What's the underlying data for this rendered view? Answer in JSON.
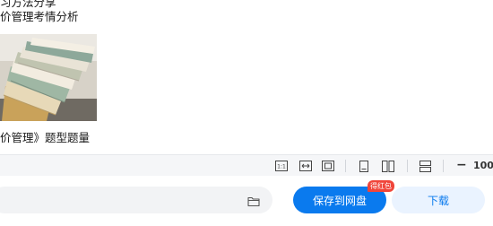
{
  "document": {
    "line1": "习方法分享",
    "line2": "价管理考情分析",
    "line3": "价管理》题型题量"
  },
  "toolbar": {
    "zoom_value": "100",
    "zoom_minus_label": "−"
  },
  "actions": {
    "save_label": "保存到网盘",
    "save_badge": "得红包",
    "download_label": "下载"
  },
  "colors": {
    "primary": "#0a7aee",
    "badge": "#f0453a",
    "download_bg": "#eaf3ff"
  }
}
